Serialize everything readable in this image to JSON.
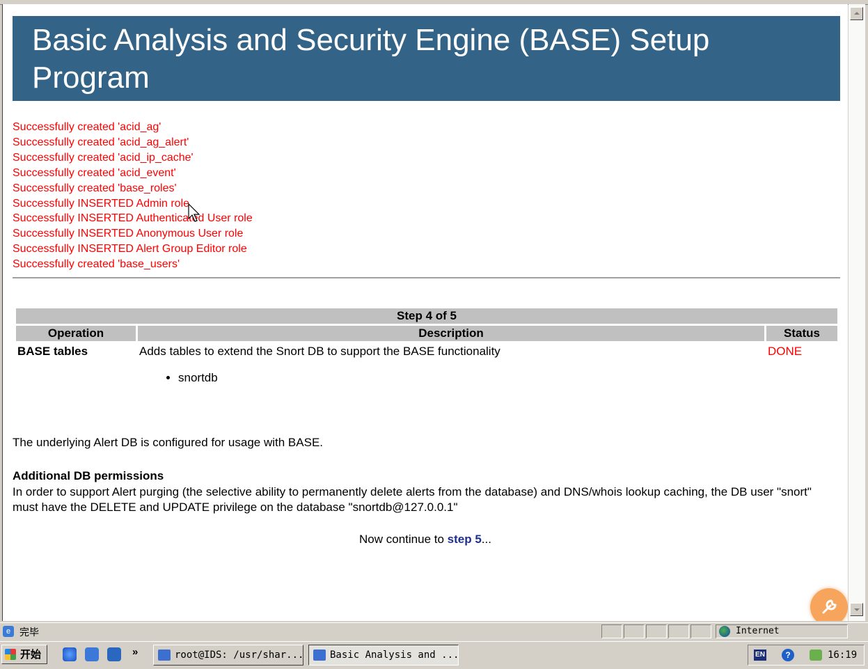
{
  "page": {
    "title": "Basic Analysis and Security Engine (BASE) Setup Program",
    "messages": [
      "Successfully created 'acid_ag'",
      "Successfully created 'acid_ag_alert'",
      "Successfully created 'acid_ip_cache'",
      "Successfully created 'acid_event'",
      "Successfully created 'base_roles'",
      "Successfully INSERTED Admin role",
      "Successfully INSERTED Authenticated User role",
      "Successfully INSERTED Anonymous User role",
      "Successfully INSERTED Alert Group Editor role",
      "Successfully created 'base_users'"
    ],
    "step_table": {
      "step_label": "Step 4 of 5",
      "headers": {
        "operation": "Operation",
        "description": "Description",
        "status": "Status"
      },
      "row": {
        "operation": "BASE tables",
        "description": "Adds tables to extend the Snort DB to support the BASE functionality",
        "status": "DONE",
        "databases": [
          "snortdb"
        ]
      }
    },
    "configured_text": "The underlying Alert DB is configured for usage with BASE.",
    "permissions": {
      "heading": "Additional DB permissions",
      "body": "In order to support Alert purging (the selective ability to permanently delete alerts from the database) and DNS/whois lookup caching, the DB user \"snort\" must have the DELETE and UPDATE privilege on the database \"snortdb@127.0.0.1\""
    },
    "continue": {
      "prefix": "Now continue to ",
      "link": "step 5",
      "suffix": "..."
    }
  },
  "statusbar": {
    "text": "完毕",
    "zone": "Internet"
  },
  "taskbar": {
    "start_label": "开始",
    "more": "»",
    "tasks": [
      {
        "label": "root@IDS: /usr/shar..."
      },
      {
        "label": "Basic Analysis and ..."
      }
    ],
    "tray": {
      "lang": "EN",
      "clock": "16:19"
    }
  },
  "colors": {
    "banner": "#336487",
    "message": "#ff0000",
    "link": "#1f2f8f",
    "fab": "#f7a55c"
  }
}
